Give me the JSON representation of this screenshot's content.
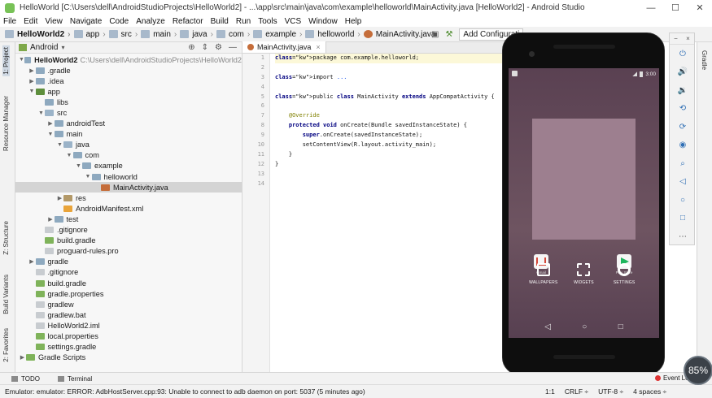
{
  "window": {
    "title": "HelloWorld [C:\\Users\\dell\\AndroidStudioProjects\\HelloWorld2] - ...\\app\\src\\main\\java\\com\\example\\helloworld\\MainActivity.java [HelloWorld2] - Android Studio"
  },
  "window_buttons": [
    "—",
    "☐",
    "✕"
  ],
  "menu": [
    "File",
    "Edit",
    "View",
    "Navigate",
    "Code",
    "Analyze",
    "Refactor",
    "Build",
    "Run",
    "Tools",
    "VCS",
    "Window",
    "Help"
  ],
  "breadcrumb": [
    "HelloWorld2",
    "app",
    "src",
    "main",
    "java",
    "com",
    "example",
    "helloworld",
    "MainActivity.java"
  ],
  "toolbar": {
    "config_label": "Add Configurati"
  },
  "left_tabs": [
    "1: Project",
    "Resource Manager",
    "Z: Structure",
    "Build Variants",
    "2: Favorites"
  ],
  "right_tabs": [
    "Gradle"
  ],
  "project_panel": {
    "view_mode": "Android",
    "tree": [
      {
        "label": "HelloWorld2",
        "path": "C:\\Users\\dell\\AndroidStudioProjects\\HelloWorld2",
        "depth": 0,
        "arrow": "down",
        "icon": "folder"
      },
      {
        "label": ".gradle",
        "depth": 1,
        "arrow": "right",
        "icon": "folder"
      },
      {
        "label": ".idea",
        "depth": 1,
        "arrow": "right",
        "icon": "folder"
      },
      {
        "label": "app",
        "depth": 1,
        "arrow": "down",
        "icon": "app"
      },
      {
        "label": "libs",
        "depth": 2,
        "arrow": "",
        "icon": "folder"
      },
      {
        "label": "src",
        "depth": 2,
        "arrow": "down",
        "icon": "src"
      },
      {
        "label": "androidTest",
        "depth": 3,
        "arrow": "right",
        "icon": "folder"
      },
      {
        "label": "main",
        "depth": 3,
        "arrow": "down",
        "icon": "folder"
      },
      {
        "label": "java",
        "depth": 4,
        "arrow": "down",
        "icon": "src"
      },
      {
        "label": "com",
        "depth": 5,
        "arrow": "down",
        "icon": "folder"
      },
      {
        "label": "example",
        "depth": 6,
        "arrow": "down",
        "icon": "folder"
      },
      {
        "label": "helloworld",
        "depth": 7,
        "arrow": "down",
        "icon": "folder"
      },
      {
        "label": "MainActivity.java",
        "depth": 8,
        "arrow": "",
        "icon": "java",
        "selected": true
      },
      {
        "label": "res",
        "depth": 4,
        "arrow": "right",
        "icon": "res"
      },
      {
        "label": "AndroidManifest.xml",
        "depth": 4,
        "arrow": "",
        "icon": "xml"
      },
      {
        "label": "test",
        "depth": 3,
        "arrow": "right",
        "icon": "folder"
      },
      {
        "label": ".gitignore",
        "depth": 2,
        "arrow": "",
        "icon": "file"
      },
      {
        "label": "build.gradle",
        "depth": 2,
        "arrow": "",
        "icon": "gradle"
      },
      {
        "label": "proguard-rules.pro",
        "depth": 2,
        "arrow": "",
        "icon": "file"
      },
      {
        "label": "gradle",
        "depth": 1,
        "arrow": "right",
        "icon": "folder"
      },
      {
        "label": ".gitignore",
        "depth": 1,
        "arrow": "",
        "icon": "file"
      },
      {
        "label": "build.gradle",
        "depth": 1,
        "arrow": "",
        "icon": "gradle"
      },
      {
        "label": "gradle.properties",
        "depth": 1,
        "arrow": "",
        "icon": "gradle"
      },
      {
        "label": "gradlew",
        "depth": 1,
        "arrow": "",
        "icon": "file"
      },
      {
        "label": "gradlew.bat",
        "depth": 1,
        "arrow": "",
        "icon": "file"
      },
      {
        "label": "HelloWorld2.iml",
        "depth": 1,
        "arrow": "",
        "icon": "file"
      },
      {
        "label": "local.properties",
        "depth": 1,
        "arrow": "",
        "icon": "gradle"
      },
      {
        "label": "settings.gradle",
        "depth": 1,
        "arrow": "",
        "icon": "gradle"
      },
      {
        "label": "Gradle Scripts",
        "depth": 0,
        "arrow": "right",
        "icon": "gradle"
      }
    ]
  },
  "editor": {
    "tab_label": "MainActivity.java",
    "line_numbers": [
      "1",
      "2",
      "3",
      "4",
      "5",
      "6",
      "7",
      "8",
      "9",
      "10",
      "11",
      "12",
      "13",
      "14"
    ],
    "lines": [
      "package com.example.helloworld;",
      "",
      "import ...",
      "",
      "public class MainActivity extends AppCompatActivity {",
      "",
      "    @Override",
      "    protected void onCreate(Bundle savedInstanceState) {",
      "        super.onCreate(savedInstanceState);",
      "        setContentView(R.layout.activity_main);",
      "    }",
      "}",
      "",
      ""
    ]
  },
  "bottom_tools": {
    "todo": "TODO",
    "terminal": "Terminal",
    "event_log": "Event Lo"
  },
  "status": {
    "message": "Emulator: emulator: ERROR: AdbHostServer.cpp:93: Unable to connect to adb daemon on port: 5037 (5 minutes ago)",
    "position": "1:1",
    "line_sep": "CRLF ÷",
    "encoding": "UTF-8 ÷",
    "indent": "4 spaces ÷"
  },
  "emulator": {
    "time": "3:00",
    "apps": [
      "Gmail",
      "Play Store"
    ],
    "menu": [
      "WALLPAPERS",
      "WIDGETS",
      "SETTINGS"
    ],
    "zoom": "85"
  }
}
